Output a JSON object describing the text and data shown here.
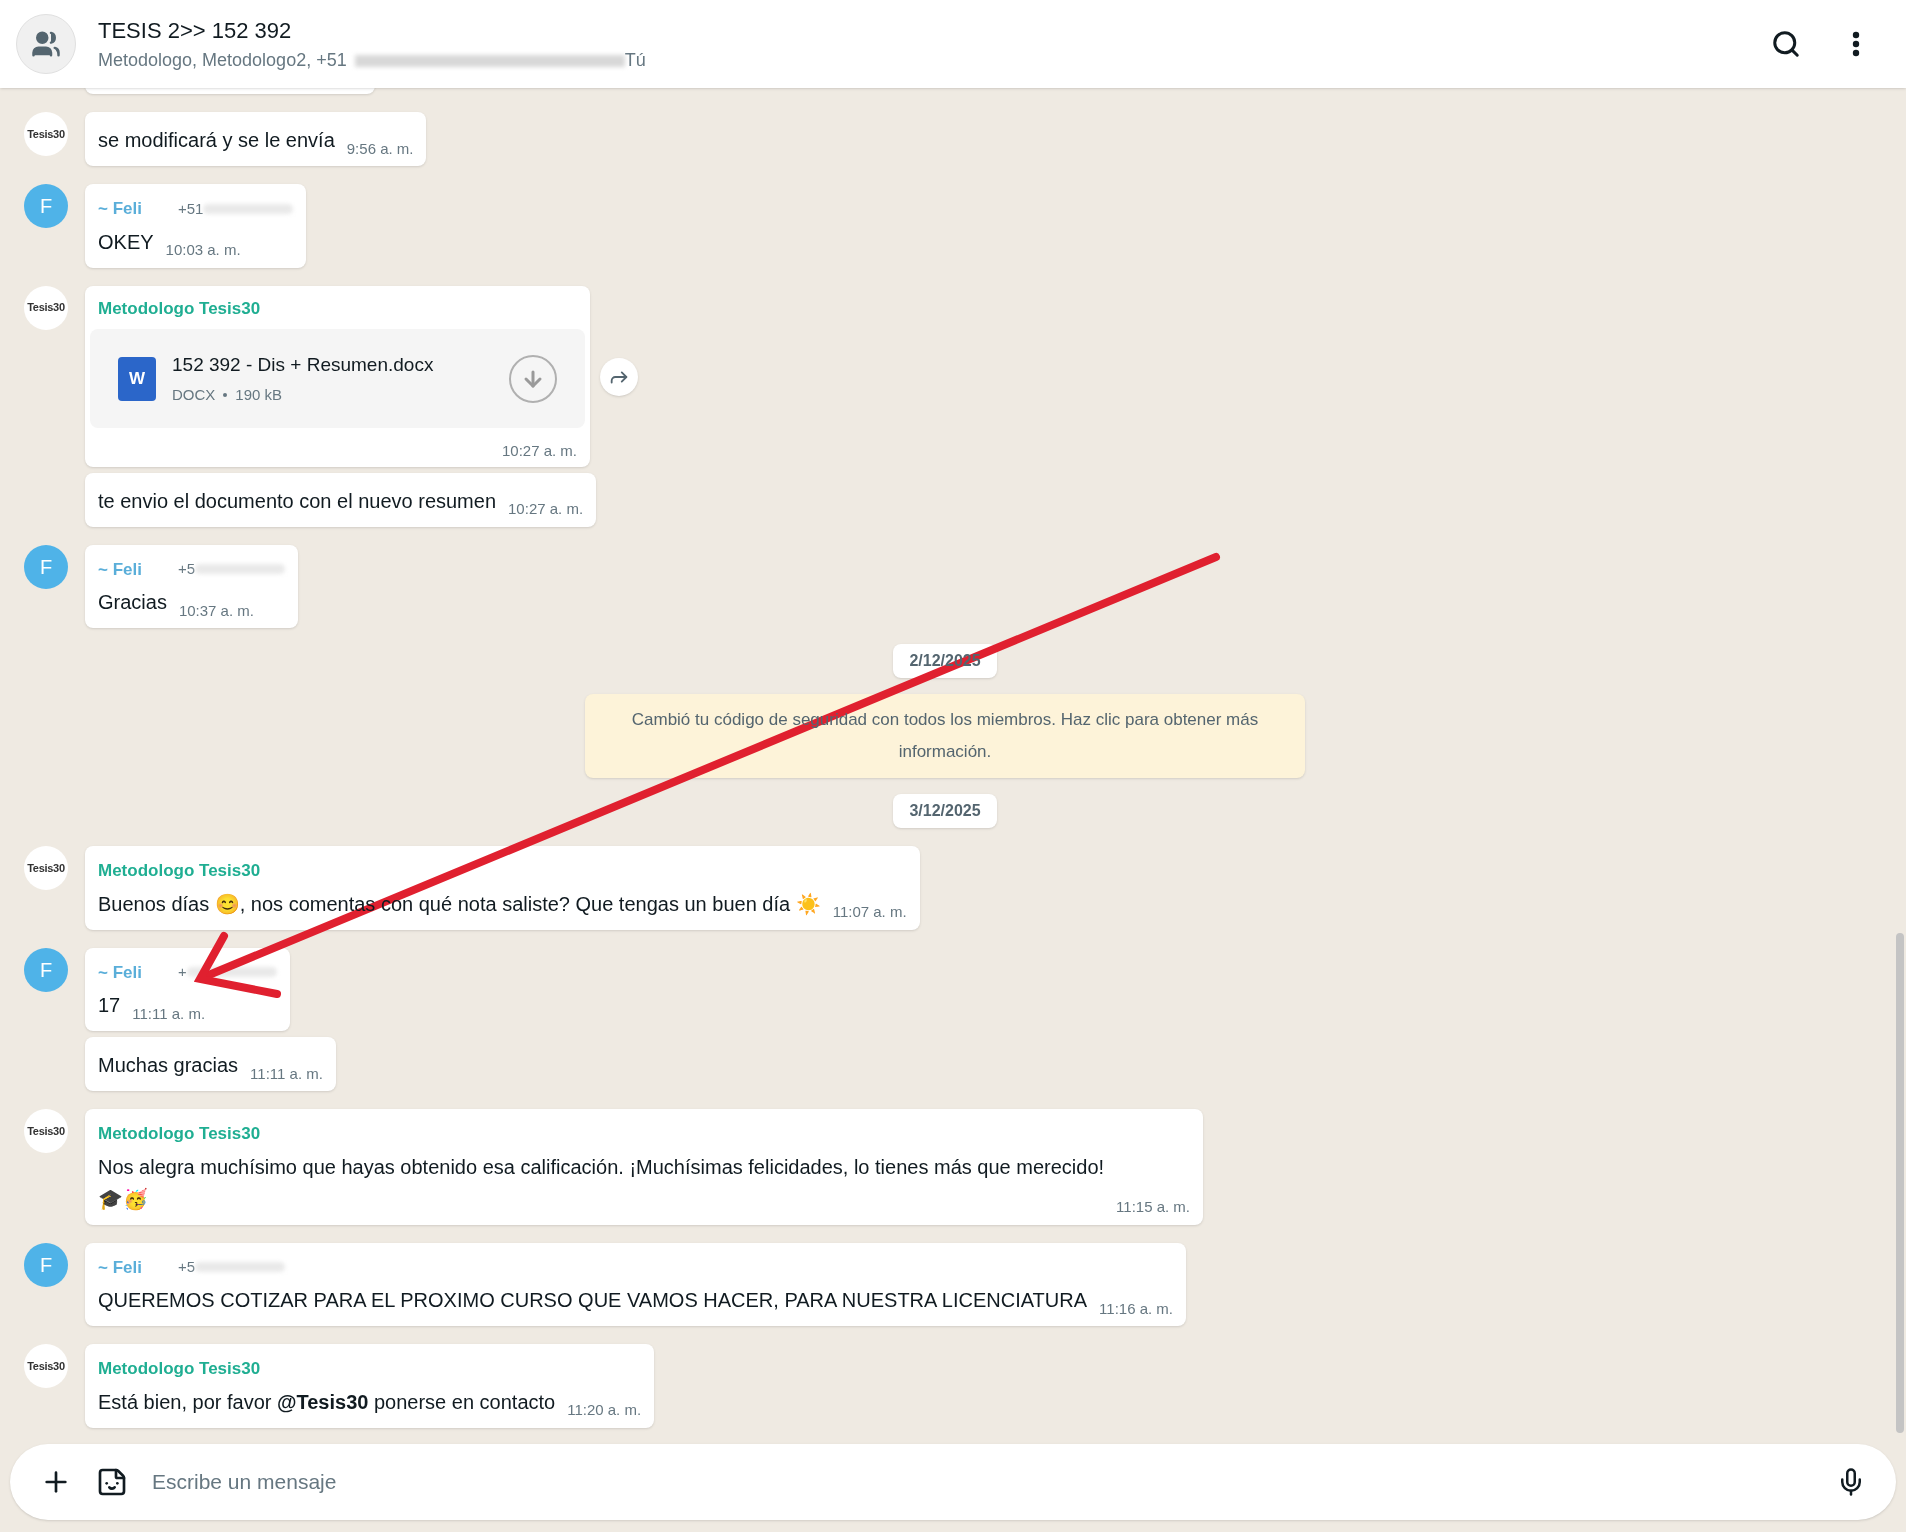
{
  "header": {
    "title": "TESIS 2>> 152 392",
    "subtitle": "Metodologo, Metodologo2, +51",
    "subtitle_end": "Tú"
  },
  "messages": [
    {
      "kind": "text",
      "avatar": {
        "kind": "logo",
        "text": "Tesis30"
      },
      "text": "se modificará y se le envía",
      "time": "9:56 a. m."
    },
    {
      "kind": "text",
      "avatar": {
        "kind": "letter",
        "text": "F"
      },
      "sender": {
        "name": "~ Feli",
        "phone": "+51",
        "color": "#5aaed9"
      },
      "text": "OKEY",
      "time": "10:03 a. m."
    },
    {
      "kind": "file",
      "avatar": {
        "kind": "logo",
        "text": "Tesis30"
      },
      "sender": {
        "name": "Metodologo Tesis30",
        "color": "#1fae92"
      },
      "file": {
        "icon": "W",
        "name": "152 392 - Dis + Resumen.docx",
        "type": "DOCX",
        "size": "190 kB"
      },
      "time": "10:27 a. m."
    },
    {
      "kind": "text",
      "text": "te envio el documento con el nuevo resumen",
      "time": "10:27 a. m."
    },
    {
      "kind": "text",
      "avatar": {
        "kind": "letter",
        "text": "F"
      },
      "sender": {
        "name": "~ Feli",
        "phone": "+5",
        "color": "#5aaed9"
      },
      "text": "Gracias",
      "time": "10:37 a. m."
    },
    {
      "kind": "date",
      "text": "2/12/2025"
    },
    {
      "kind": "system",
      "text": "Cambió tu código de seguridad con todos los miembros. Haz clic para obtener más información."
    },
    {
      "kind": "date",
      "text": "3/12/2025"
    },
    {
      "kind": "text",
      "avatar": {
        "kind": "logo",
        "text": "Tesis30"
      },
      "sender": {
        "name": "Metodologo Tesis30",
        "color": "#1fae92"
      },
      "text": "Buenos días 😊, nos comentas con qué nota saliste? Que tengas un buen día ☀️",
      "time": "11:07 a. m."
    },
    {
      "kind": "text",
      "avatar": {
        "kind": "letter",
        "text": "F"
      },
      "sender": {
        "name": "~ Feli",
        "phone": "+",
        "color": "#5aaed9"
      },
      "text": "17",
      "time": "11:11 a. m."
    },
    {
      "kind": "text",
      "text": "Muchas gracias",
      "time": "11:11 a. m."
    },
    {
      "kind": "text",
      "avatar": {
        "kind": "logo",
        "text": "Tesis30"
      },
      "sender": {
        "name": "Metodologo Tesis30",
        "color": "#1fae92"
      },
      "text": "Nos alegra muchísimo que hayas obtenido esa calificación. ¡Muchísimas felicidades, lo tienes más que merecido!\n🎓🥳",
      "time": "11:15 a. m."
    },
    {
      "kind": "text",
      "avatar": {
        "kind": "letter",
        "text": "F"
      },
      "sender": {
        "name": "~ Feli",
        "phone": "+5",
        "color": "#5aaed9"
      },
      "text": "QUEREMOS COTIZAR PARA EL PROXIMO CURSO QUE VAMOS HACER, PARA NUESTRA LICENCIATURA",
      "time": "11:16 a. m."
    },
    {
      "kind": "text",
      "avatar": {
        "kind": "logo",
        "text": "Tesis30"
      },
      "sender": {
        "name": "Metodologo Tesis30",
        "color": "#1fae92"
      },
      "text": "Está bien, por favor **@Tesis30** ponerse en contacto",
      "time": "11:20 a. m."
    }
  ],
  "composer": {
    "placeholder": "Escribe un mensaje"
  }
}
